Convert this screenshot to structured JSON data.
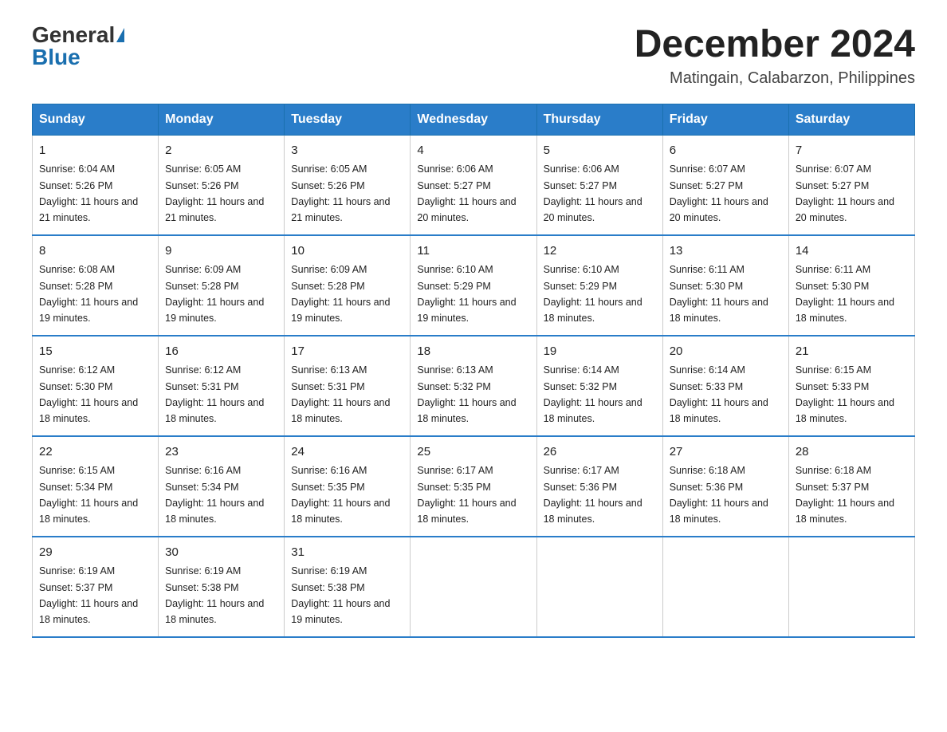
{
  "logo": {
    "general": "General",
    "blue": "Blue"
  },
  "title": "December 2024",
  "location": "Matingain, Calabarzon, Philippines",
  "header_days": [
    "Sunday",
    "Monday",
    "Tuesday",
    "Wednesday",
    "Thursday",
    "Friday",
    "Saturday"
  ],
  "weeks": [
    [
      {
        "day": "1",
        "sunrise": "6:04 AM",
        "sunset": "5:26 PM",
        "daylight": "11 hours and 21 minutes."
      },
      {
        "day": "2",
        "sunrise": "6:05 AM",
        "sunset": "5:26 PM",
        "daylight": "11 hours and 21 minutes."
      },
      {
        "day": "3",
        "sunrise": "6:05 AM",
        "sunset": "5:26 PM",
        "daylight": "11 hours and 21 minutes."
      },
      {
        "day": "4",
        "sunrise": "6:06 AM",
        "sunset": "5:27 PM",
        "daylight": "11 hours and 20 minutes."
      },
      {
        "day": "5",
        "sunrise": "6:06 AM",
        "sunset": "5:27 PM",
        "daylight": "11 hours and 20 minutes."
      },
      {
        "day": "6",
        "sunrise": "6:07 AM",
        "sunset": "5:27 PM",
        "daylight": "11 hours and 20 minutes."
      },
      {
        "day": "7",
        "sunrise": "6:07 AM",
        "sunset": "5:27 PM",
        "daylight": "11 hours and 20 minutes."
      }
    ],
    [
      {
        "day": "8",
        "sunrise": "6:08 AM",
        "sunset": "5:28 PM",
        "daylight": "11 hours and 19 minutes."
      },
      {
        "day": "9",
        "sunrise": "6:09 AM",
        "sunset": "5:28 PM",
        "daylight": "11 hours and 19 minutes."
      },
      {
        "day": "10",
        "sunrise": "6:09 AM",
        "sunset": "5:28 PM",
        "daylight": "11 hours and 19 minutes."
      },
      {
        "day": "11",
        "sunrise": "6:10 AM",
        "sunset": "5:29 PM",
        "daylight": "11 hours and 19 minutes."
      },
      {
        "day": "12",
        "sunrise": "6:10 AM",
        "sunset": "5:29 PM",
        "daylight": "11 hours and 18 minutes."
      },
      {
        "day": "13",
        "sunrise": "6:11 AM",
        "sunset": "5:30 PM",
        "daylight": "11 hours and 18 minutes."
      },
      {
        "day": "14",
        "sunrise": "6:11 AM",
        "sunset": "5:30 PM",
        "daylight": "11 hours and 18 minutes."
      }
    ],
    [
      {
        "day": "15",
        "sunrise": "6:12 AM",
        "sunset": "5:30 PM",
        "daylight": "11 hours and 18 minutes."
      },
      {
        "day": "16",
        "sunrise": "6:12 AM",
        "sunset": "5:31 PM",
        "daylight": "11 hours and 18 minutes."
      },
      {
        "day": "17",
        "sunrise": "6:13 AM",
        "sunset": "5:31 PM",
        "daylight": "11 hours and 18 minutes."
      },
      {
        "day": "18",
        "sunrise": "6:13 AM",
        "sunset": "5:32 PM",
        "daylight": "11 hours and 18 minutes."
      },
      {
        "day": "19",
        "sunrise": "6:14 AM",
        "sunset": "5:32 PM",
        "daylight": "11 hours and 18 minutes."
      },
      {
        "day": "20",
        "sunrise": "6:14 AM",
        "sunset": "5:33 PM",
        "daylight": "11 hours and 18 minutes."
      },
      {
        "day": "21",
        "sunrise": "6:15 AM",
        "sunset": "5:33 PM",
        "daylight": "11 hours and 18 minutes."
      }
    ],
    [
      {
        "day": "22",
        "sunrise": "6:15 AM",
        "sunset": "5:34 PM",
        "daylight": "11 hours and 18 minutes."
      },
      {
        "day": "23",
        "sunrise": "6:16 AM",
        "sunset": "5:34 PM",
        "daylight": "11 hours and 18 minutes."
      },
      {
        "day": "24",
        "sunrise": "6:16 AM",
        "sunset": "5:35 PM",
        "daylight": "11 hours and 18 minutes."
      },
      {
        "day": "25",
        "sunrise": "6:17 AM",
        "sunset": "5:35 PM",
        "daylight": "11 hours and 18 minutes."
      },
      {
        "day": "26",
        "sunrise": "6:17 AM",
        "sunset": "5:36 PM",
        "daylight": "11 hours and 18 minutes."
      },
      {
        "day": "27",
        "sunrise": "6:18 AM",
        "sunset": "5:36 PM",
        "daylight": "11 hours and 18 minutes."
      },
      {
        "day": "28",
        "sunrise": "6:18 AM",
        "sunset": "5:37 PM",
        "daylight": "11 hours and 18 minutes."
      }
    ],
    [
      {
        "day": "29",
        "sunrise": "6:19 AM",
        "sunset": "5:37 PM",
        "daylight": "11 hours and 18 minutes."
      },
      {
        "day": "30",
        "sunrise": "6:19 AM",
        "sunset": "5:38 PM",
        "daylight": "11 hours and 18 minutes."
      },
      {
        "day": "31",
        "sunrise": "6:19 AM",
        "sunset": "5:38 PM",
        "daylight": "11 hours and 19 minutes."
      },
      null,
      null,
      null,
      null
    ]
  ]
}
